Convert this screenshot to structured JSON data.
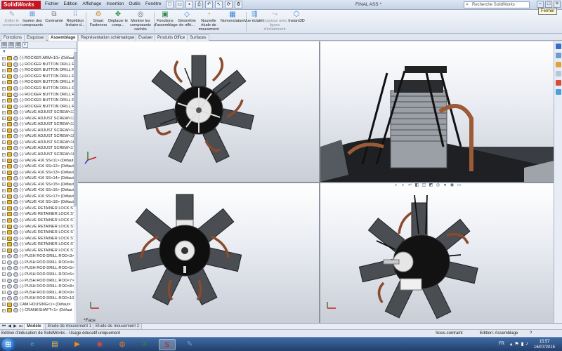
{
  "app": {
    "logo_prefix": "Solid",
    "logo_suffix": "Works",
    "document_title": "FINAL ASS *"
  },
  "menu": [
    "Fichier",
    "Edition",
    "Affichage",
    "Insertion",
    "Outils",
    "Fenêtre"
  ],
  "search": {
    "placeholder": "Recherche SolidWorks"
  },
  "tooltip": "Fermer",
  "commands": [
    {
      "label": "Editer le composant",
      "icon": "edit-component-icon",
      "disabled": true
    },
    {
      "label": "Insérer des composants",
      "icon": "insert-components-icon",
      "disabled": false
    },
    {
      "label": "Contrainte",
      "icon": "mate-icon",
      "disabled": false
    },
    {
      "label": "Répétition linéaire d...",
      "icon": "linear-pattern-icon",
      "disabled": false
    },
    {
      "label": "Smart Fasteners",
      "icon": "smart-fasteners-icon",
      "disabled": false
    },
    {
      "label": "Déplacer le comp...",
      "icon": "move-component-icon",
      "disabled": false
    },
    {
      "label": "Montrer les composants cachés",
      "icon": "show-hidden-icon",
      "disabled": false
    },
    {
      "label": "Fonctions d'assemblage",
      "icon": "assembly-features-icon",
      "disabled": false
    },
    {
      "label": "Géométrie de réfé...",
      "icon": "reference-geometry-icon",
      "disabled": false
    },
    {
      "label": "Nouvelle étude de mouvement",
      "icon": "motion-study-icon",
      "disabled": false
    },
    {
      "label": "Nomenclature",
      "icon": "bom-icon",
      "disabled": false
    },
    {
      "label": "Vue éclatée",
      "icon": "exploded-view-icon",
      "disabled": false
    },
    {
      "label": "Esquisse avec lignes d'éclatement",
      "icon": "explode-line-sketch-icon",
      "disabled": true
    },
    {
      "label": "Instant3D",
      "icon": "instant3d-icon",
      "disabled": false
    }
  ],
  "tabs": [
    {
      "label": "Fonctions",
      "active": false
    },
    {
      "label": "Esquisse",
      "active": false
    },
    {
      "label": "Assemblage",
      "active": true
    },
    {
      "label": "Représentation schématique",
      "active": false
    },
    {
      "label": "Evaluer",
      "active": false
    },
    {
      "label": "Produits Office",
      "active": false
    },
    {
      "label": "Surfaces",
      "active": false
    }
  ],
  "tree": {
    "items": [
      "(-) ROCKER ARM<10> (Défaut",
      "(-) ROCKER BUTTON DRILL R",
      "(-) ROCKER BUTTON DRILL R",
      "(-) ROCKER BUTTON DRILL R",
      "(-) ROCKER BUTTON DRILL R",
      "(-) ROCKER BUTTON DRILL R",
      "(-) ROCKER BUTTON DRILL R",
      "(-) ROCKER BUTTON DRILL R",
      "(-) ROCKER BUTTON DRILL R",
      "(-) VALVE ADJUST SCREW<11",
      "(-) VALVE ADJUST SCREW<12",
      "(-) VALVE ADJUST SCREW<13",
      "(-) VALVE ADJUST SCREW<14",
      "(-) VALVE ADJUST SCREW<15",
      "(-) VALVE ADJUST SCREW<16",
      "(-) VALVE ADJUST SCREW<17",
      "(-) VALVE ADJUST SCREW<18",
      "(-) VALVE 416 SS<11> (Défaut",
      "(-) VALVE 416 SS<12> (Défaut",
      "(-) VALVE 416 SS<13> (Défaut",
      "(-) VALVE 416 SS<14> (Défaut",
      "(-) VALVE 416 SS<15> (Défaut",
      "(-) VALVE 416 SS<16> (Défaut",
      "(-) VALVE 416 SS<17> (Défaut",
      "(-) VALVE 416 SS<18> (Défaut",
      "(-) VALVE RETAINER LOCK ST",
      "(-) VALVE RETAINER LOCK ST",
      "(-) VALVE RETAINER LOCK ST",
      "(-) VALVE RETAINER LOCK ST",
      "(-) VALVE RETAINER LOCK ST",
      "(-) VALVE RETAINER LOCK ST",
      "(-) VALVE RETAINER LOCK ST",
      "(-) VALVE RETAINER LOCK ST",
      "(-) PUSH ROD DRILL ROD<3>",
      "(-) PUSH ROD DRILL ROD<4>",
      "(-) PUSH ROD DRILL ROD<5>",
      "(-) PUSH ROD DRILL ROD<6>",
      "(-) PUSH ROD DRILL ROD<7>",
      "(-) PUSH ROD DRILL ROD<8>",
      "(-) PUSH ROD DRILL ROD<9>",
      "(-) PUSH ROD DRILL ROD<10",
      "CAM HOUSING<1> (Défaut<",
      "(-) CRANKSHAFT<1> (Défaut"
    ]
  },
  "viewports": {
    "bottom_left_label": "*Face"
  },
  "bottom_tabs": [
    {
      "label": "Modèle",
      "active": true
    },
    {
      "label": "Etude de mouvement 1",
      "active": false
    },
    {
      "label": "Etude de mouvement 2",
      "active": false
    }
  ],
  "status": {
    "left": "Edition d'éducation de SolidWorks - Usage éducatif uniquement",
    "state": "Sous-contraint",
    "mode": "Edition: Assemblage"
  },
  "taskbar": {
    "apps": [
      {
        "name": "internet-explorer-icon",
        "glyph": "e",
        "color": "#3aa0e6"
      },
      {
        "name": "file-explorer-icon",
        "glyph": "▤",
        "color": "#e8c24a"
      },
      {
        "name": "media-player-icon",
        "glyph": "▶",
        "color": "#f08a1c"
      },
      {
        "name": "chrome-icon",
        "glyph": "◉",
        "color": "#e04a3a"
      },
      {
        "name": "firefox-icon",
        "glyph": "◍",
        "color": "#f07a1c"
      },
      {
        "name": "excel-icon",
        "glyph": "X",
        "color": "#2e8b3e"
      },
      {
        "name": "solidworks-icon",
        "glyph": "S",
        "color": "#c8141e"
      },
      {
        "name": "paint-icon",
        "glyph": "✎",
        "color": "#6aa2e0"
      }
    ],
    "language": "FR",
    "time": "15:57",
    "date": "16/07/2015"
  }
}
